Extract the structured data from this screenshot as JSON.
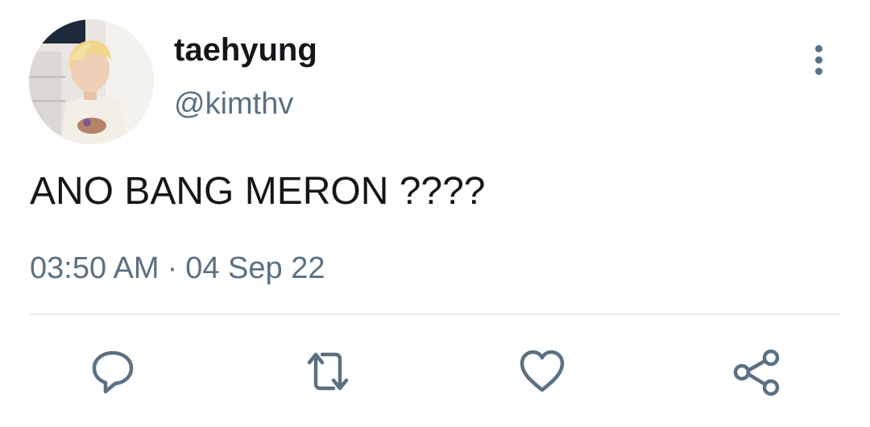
{
  "tweet": {
    "author": {
      "display_name": "taehyung",
      "handle": "@kimthv",
      "avatar_icon": "profile-photo"
    },
    "text": "ANO BANG MERON ????",
    "time": "03:50 AM",
    "separator": "·",
    "date": "04 Sep 22"
  },
  "actions": [
    {
      "name": "reply",
      "icon": "speech-bubble-icon"
    },
    {
      "name": "retweet",
      "icon": "retweet-arrows-icon"
    },
    {
      "name": "like",
      "icon": "heart-icon"
    },
    {
      "name": "share",
      "icon": "share-nodes-icon"
    }
  ],
  "colors": {
    "text_primary": "#14171a",
    "text_secondary": "#5b7083",
    "divider": "#e6ecf0",
    "background": "#ffffff"
  }
}
